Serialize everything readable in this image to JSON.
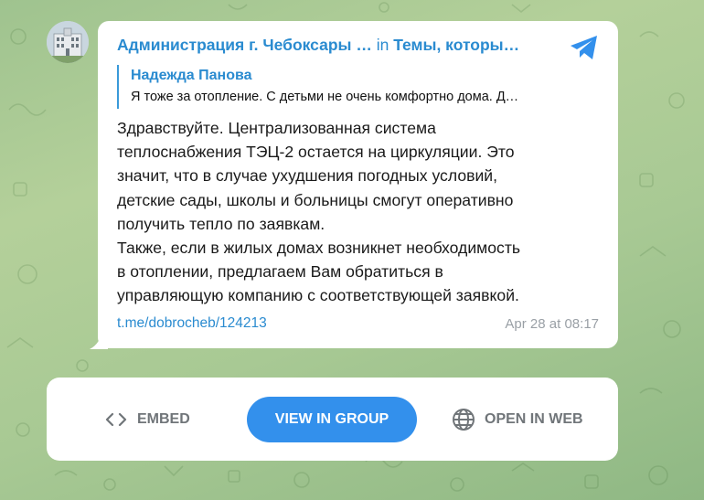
{
  "post": {
    "channel_name": "Администрация г. Чебоксары …",
    "in_word": "in",
    "topic_name": "Темы, которы…",
    "reply": {
      "author": "Надежда Панова",
      "text": "Я тоже за отопление. С детьми не очень комфортно дома. Д…"
    },
    "body_paragraphs": [
      "Здравствуйте. Централизованная система\nтеплоснабжения ТЭЦ-2 остается на циркуляции. Это\nзначит, что в случае ухудшения погодных условий,\nдетские сады, школы и больницы смогут оперативно\nполучить тепло по заявкам.",
      "Также, если в жилых домах возникнет необходимость\nв отоплении, предлагаем Вам обратиться в\nуправляющую компанию с соответствующей заявкой."
    ],
    "link": "t.me/dobrocheb/124213",
    "timestamp": "Apr 28 at 08:17"
  },
  "actions": {
    "embed_label": "EMBED",
    "view_label": "VIEW IN GROUP",
    "web_label": "OPEN IN WEB"
  },
  "colors": {
    "accent": "#3390ec",
    "link": "#2a8bd0",
    "muted": "#707579"
  },
  "icons": [
    "telegram-icon",
    "embed-code-icon",
    "globe-icon"
  ]
}
